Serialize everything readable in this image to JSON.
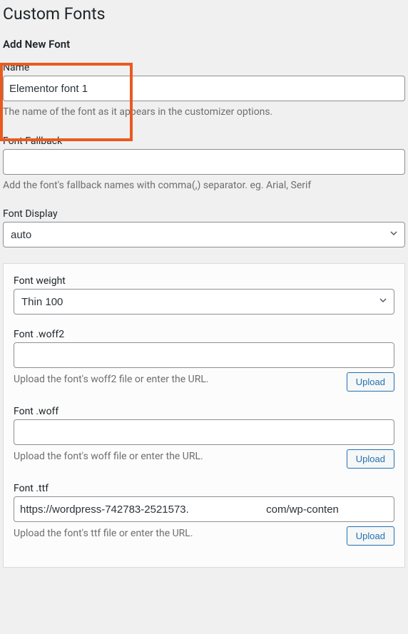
{
  "page": {
    "title": "Custom Fonts",
    "subtitle": "Add New Font"
  },
  "fields": {
    "name": {
      "label": "Name",
      "value": "Elementor font 1",
      "help": "The name of the font as it appears in the customizer options."
    },
    "fallback": {
      "label": "Font Fallback",
      "value": "",
      "help": "Add the font's fallback names with comma(,) separator. eg. Arial, Serif"
    },
    "display": {
      "label": "Font Display",
      "value": "auto"
    }
  },
  "variation": {
    "weight": {
      "label": "Font weight",
      "value": "Thin 100"
    },
    "woff2": {
      "label": "Font .woff2",
      "value": "",
      "help": "Upload the font's woff2 file or enter the URL.",
      "button": "Upload"
    },
    "woff": {
      "label": "Font .woff",
      "value": "",
      "help": "Upload the font's woff file or enter the URL.",
      "button": "Upload"
    },
    "ttf": {
      "label": "Font .ttf",
      "value": "https://wordpress-742783-2521573.                          com/wp-conten",
      "help": "Upload the font's ttf file or enter the URL.",
      "button": "Upload"
    }
  }
}
